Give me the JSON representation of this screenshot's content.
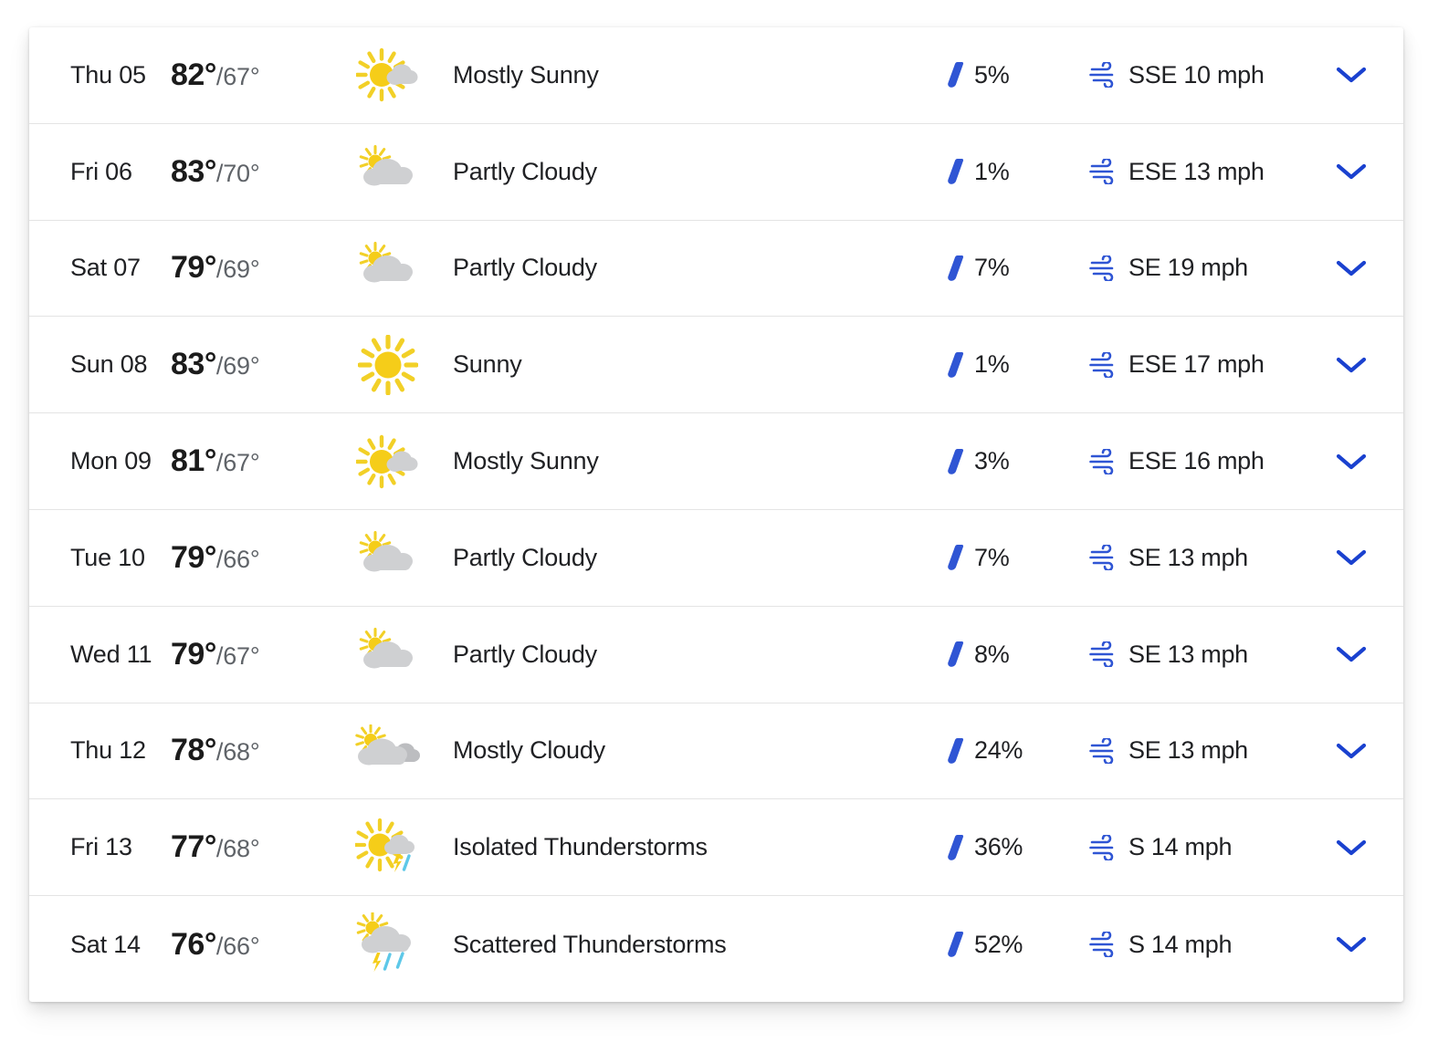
{
  "colors": {
    "accent_blue": "#2f55d4",
    "chevron_blue": "#1a41cf",
    "sun_yellow": "#f5cd19",
    "sun_ray_yellow": "#f2d027",
    "cloud_gray": "#cfd0d2",
    "cloud_gray_dark": "#bcbdc0",
    "rain_blue": "#5ec8e8",
    "text_primary": "#202124",
    "text_secondary": "#5f6368",
    "row_divider": "#e4e4e4",
    "card_bg": "#ffffff"
  },
  "icons": {
    "raindrop": "raindrop-icon",
    "wind": "wind-icon",
    "chevron": "chevron-down-icon"
  },
  "forecast": {
    "rows": [
      {
        "day": "Thu 05",
        "high": "82°",
        "low": "/67°",
        "icon": "mostly-sunny",
        "condition": "Mostly Sunny",
        "precip": "5%",
        "wind": "SSE 10 mph"
      },
      {
        "day": "Fri 06",
        "high": "83°",
        "low": "/70°",
        "icon": "partly-cloudy",
        "condition": "Partly Cloudy",
        "precip": "1%",
        "wind": "ESE 13 mph"
      },
      {
        "day": "Sat 07",
        "high": "79°",
        "low": "/69°",
        "icon": "partly-cloudy",
        "condition": "Partly Cloudy",
        "precip": "7%",
        "wind": "SE 19 mph"
      },
      {
        "day": "Sun 08",
        "high": "83°",
        "low": "/69°",
        "icon": "sunny",
        "condition": "Sunny",
        "precip": "1%",
        "wind": "ESE 17 mph"
      },
      {
        "day": "Mon 09",
        "high": "81°",
        "low": "/67°",
        "icon": "mostly-sunny",
        "condition": "Mostly Sunny",
        "precip": "3%",
        "wind": "ESE 16 mph"
      },
      {
        "day": "Tue 10",
        "high": "79°",
        "low": "/66°",
        "icon": "partly-cloudy",
        "condition": "Partly Cloudy",
        "precip": "7%",
        "wind": "SE 13 mph"
      },
      {
        "day": "Wed 11",
        "high": "79°",
        "low": "/67°",
        "icon": "partly-cloudy",
        "condition": "Partly Cloudy",
        "precip": "8%",
        "wind": "SE 13 mph"
      },
      {
        "day": "Thu 12",
        "high": "78°",
        "low": "/68°",
        "icon": "mostly-cloudy",
        "condition": "Mostly Cloudy",
        "precip": "24%",
        "wind": "SE 13 mph"
      },
      {
        "day": "Fri 13",
        "high": "77°",
        "low": "/68°",
        "icon": "isolated-thunderstorms",
        "condition": "Isolated Thunderstorms",
        "precip": "36%",
        "wind": "S 14 mph"
      },
      {
        "day": "Sat 14",
        "high": "76°",
        "low": "/66°",
        "icon": "scattered-thunderstorms",
        "condition": "Scattered Thunderstorms",
        "precip": "52%",
        "wind": "S 14 mph"
      }
    ]
  }
}
